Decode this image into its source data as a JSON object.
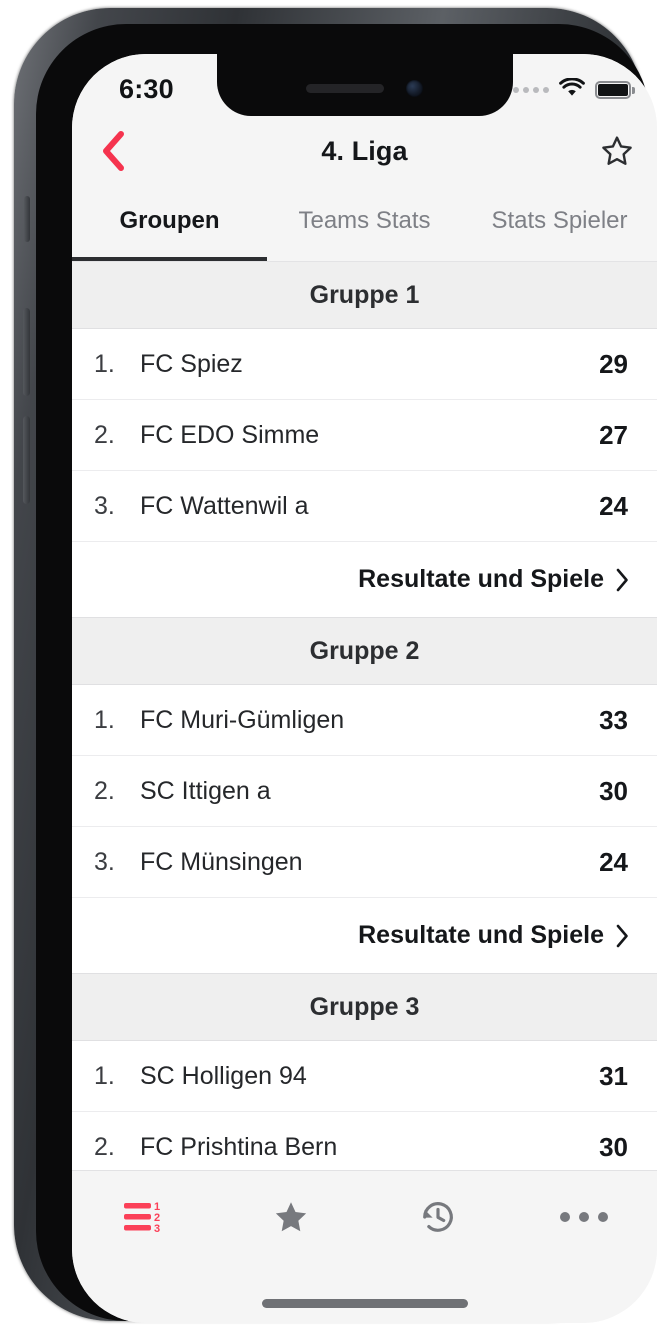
{
  "device": {
    "frame": "iphone",
    "home_indicator": "home-indicator"
  },
  "status_bar": {
    "time": "6:30",
    "signal_icon": "signal-dots-icon",
    "wifi_icon": "wifi-icon",
    "battery_icon": "battery-icon"
  },
  "nav_bar": {
    "back_icon": "chevron-left-icon",
    "title": "4. Liga",
    "favorite_icon": "star-outline-icon",
    "back_color": "#f5334e"
  },
  "tabs": {
    "items": [
      {
        "label": "Groupen",
        "active": true
      },
      {
        "label": "Teams Stats",
        "active": false
      },
      {
        "label": "Stats Spieler",
        "active": false
      }
    ]
  },
  "groups": [
    {
      "title": "Gruppe  1",
      "rows": [
        {
          "pos": "1.",
          "team": "FC Spiez",
          "points": "29"
        },
        {
          "pos": "2.",
          "team": "FC EDO Simme",
          "points": "27"
        },
        {
          "pos": "3.",
          "team": "FC Wattenwil a",
          "points": "24"
        }
      ],
      "results_label": "Resultate und Spiele"
    },
    {
      "title": "Gruppe  2",
      "rows": [
        {
          "pos": "1.",
          "team": "FC Muri-Gümligen",
          "points": "33"
        },
        {
          "pos": "2.",
          "team": "SC Ittigen a",
          "points": "30"
        },
        {
          "pos": "3.",
          "team": "FC Münsingen",
          "points": "24"
        }
      ],
      "results_label": "Resultate und Spiele"
    },
    {
      "title": "Gruppe  3",
      "rows": [
        {
          "pos": "1.",
          "team": "SC Holligen 94",
          "points": "31"
        },
        {
          "pos": "2.",
          "team": "FC Prishtina Bern",
          "points": "30"
        }
      ],
      "results_label": ""
    }
  ],
  "bottom_bar": {
    "items": [
      {
        "icon": "ranking-list-icon",
        "active": true,
        "color": "#fb4058"
      },
      {
        "icon": "star-filled-icon",
        "active": false,
        "color": "#77797e"
      },
      {
        "icon": "history-clock-icon",
        "active": false,
        "color": "#77797e"
      },
      {
        "icon": "more-dots-icon",
        "active": false,
        "color": "#77797e"
      }
    ]
  }
}
